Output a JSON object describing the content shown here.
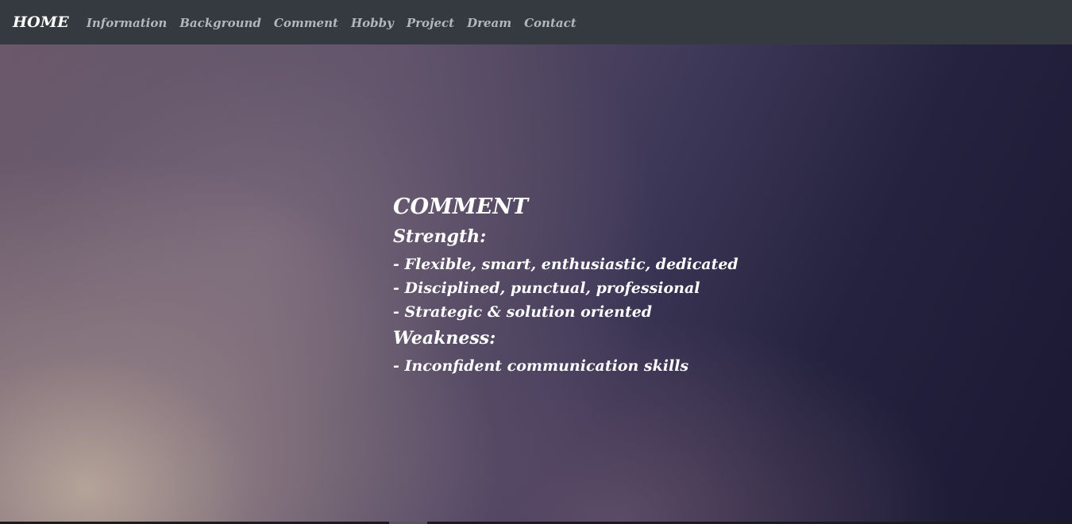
{
  "navbar": {
    "brand": "HOME",
    "links": [
      "Information",
      "Background",
      "Comment",
      "Hobby",
      "Project",
      "Dream",
      "Contact"
    ]
  },
  "comment": {
    "title": "COMMENT",
    "strength_heading": "Strength:",
    "strengths": [
      "- Flexible, smart, enthusiastic, dedicated",
      "- Disciplined, punctual, professional",
      "- Strategic & solution oriented"
    ],
    "weakness_heading": "Weakness:",
    "weaknesses": [
      "- Inconfident communication skills"
    ]
  },
  "colors": {
    "navbar_bg": "#343a40",
    "nav_link": "#b4b7ba",
    "text": "#ffffff"
  }
}
